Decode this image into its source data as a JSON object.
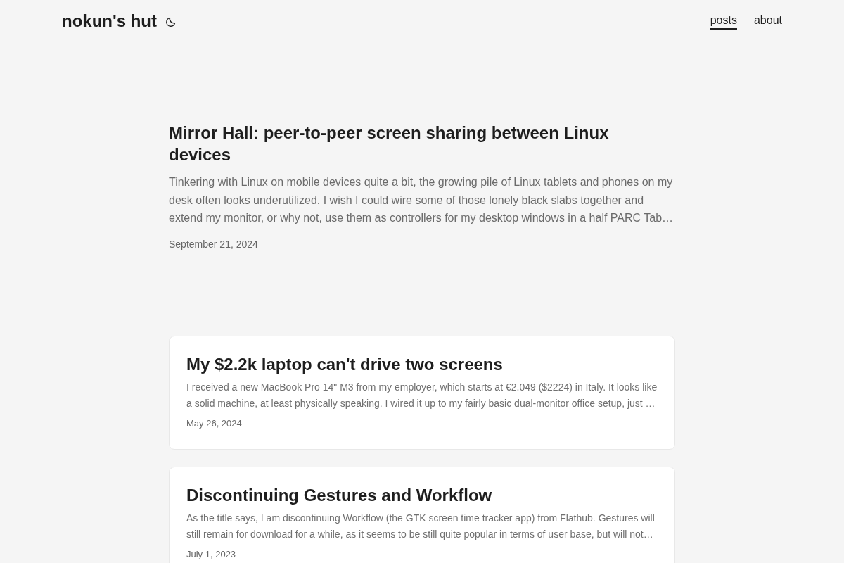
{
  "header": {
    "site_title": "nokun's hut",
    "nav": [
      {
        "label": "posts",
        "selected": true
      },
      {
        "label": "about",
        "selected": false
      }
    ]
  },
  "featured_post": {
    "title": "Mirror Hall: peer-to-peer screen sharing between Linux devices",
    "excerpt": "Tinkering with Linux on mobile devices quite a bit, the growing pile of Linux tablets and phones on my desk often looks underutilized. I wish I could wire some of those lonely black slabs together and extend my monitor, or why not, use them as controllers for my desktop windows in a half PARC Tab…",
    "date": "September 21, 2024"
  },
  "posts": [
    {
      "title": "My $2.2k laptop can't drive two screens",
      "excerpt": "I received a new MacBook Pro 14\" M3 from my employer, which starts at €2.049 ($2224) in Italy. It looks like a solid machine, at least physically speaking. I wired it up to my fairly basic dual-monitor office setup, just …",
      "date": "May 26, 2024"
    },
    {
      "title": "Discontinuing Gestures and Workflow",
      "excerpt": "As the title says, I am discontinuing Workflow (the GTK screen time tracker app) from Flathub. Gestures will still remain for download for a while, as it seems to be still quite popular in terms of user base, but will not…",
      "date": "July 1, 2023"
    }
  ]
}
